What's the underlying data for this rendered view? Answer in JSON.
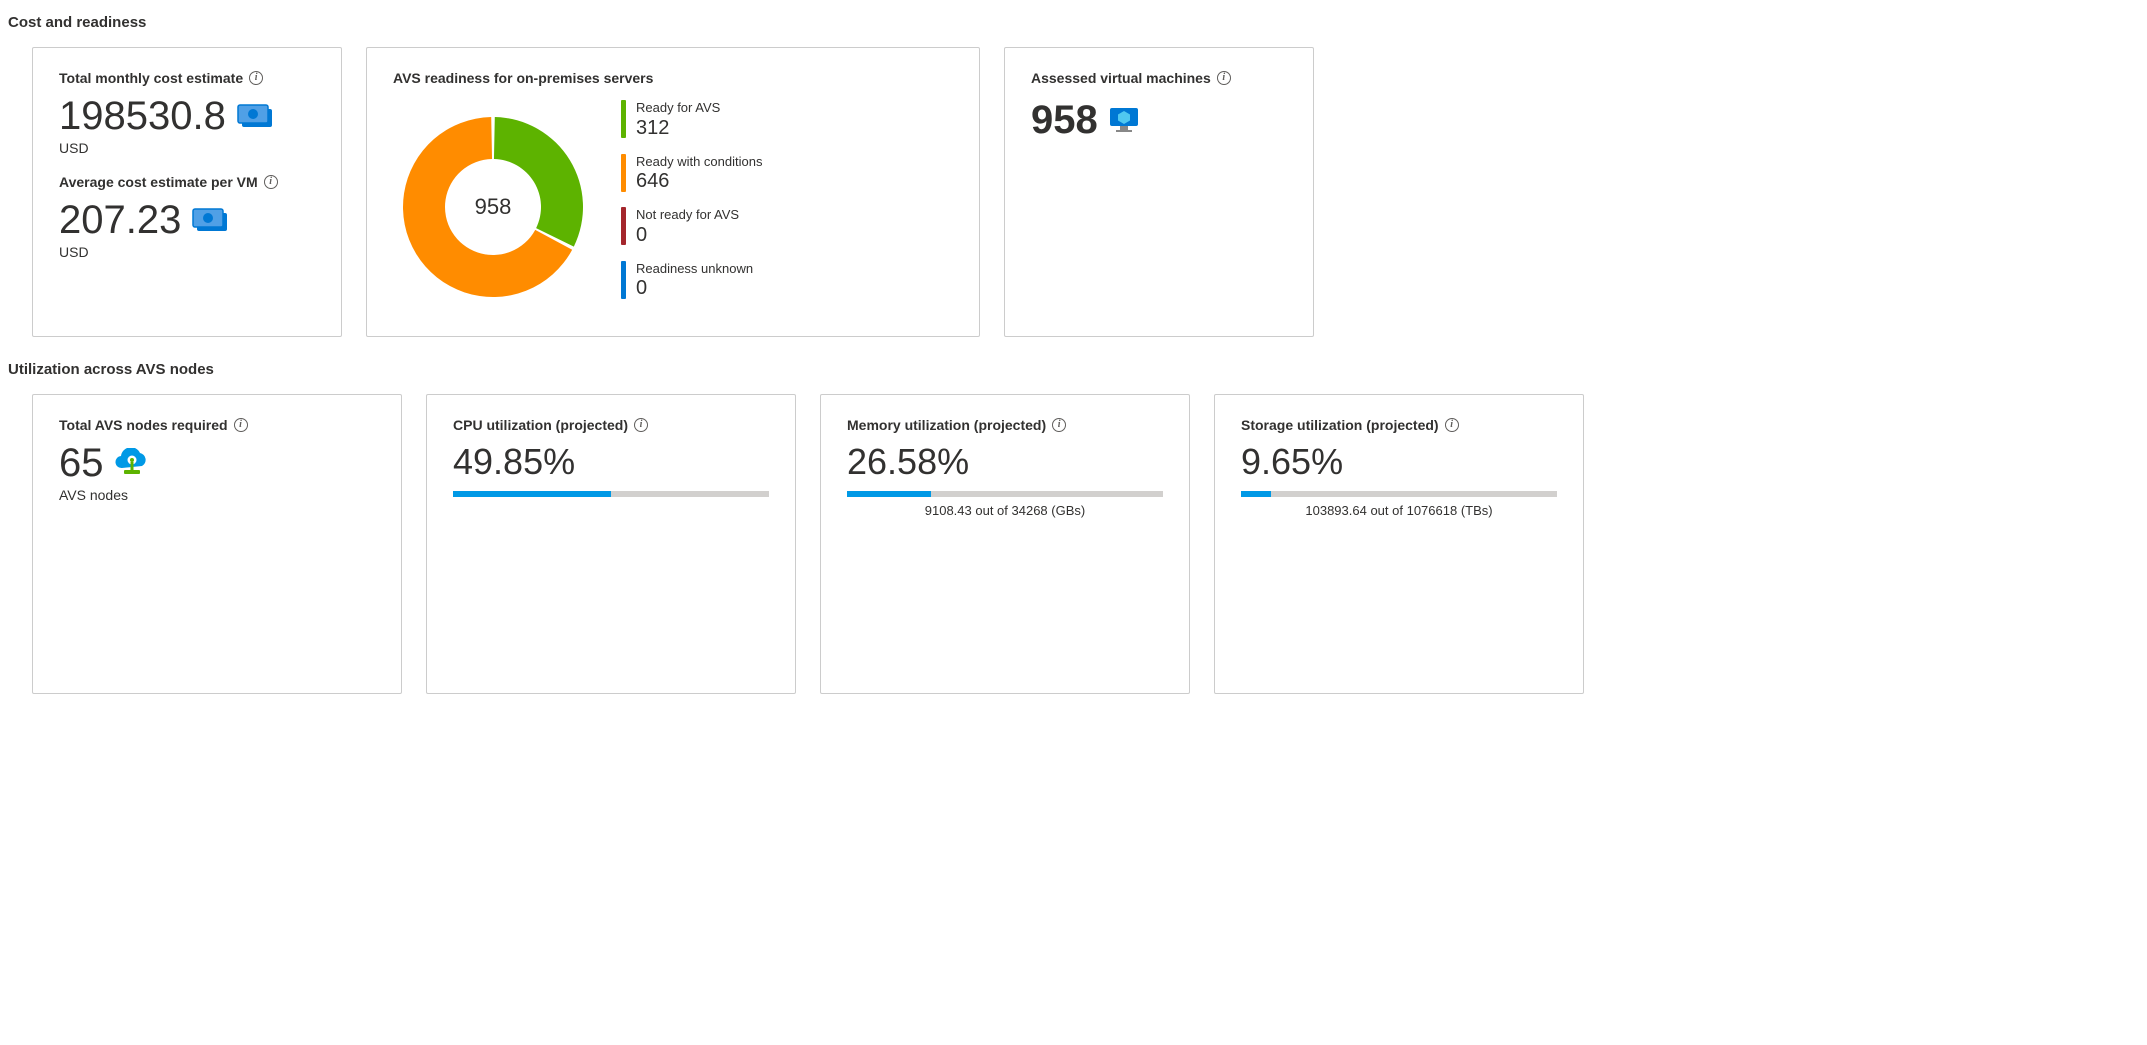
{
  "section1_title": "Cost and readiness",
  "section2_title": "Utilization across AVS nodes",
  "cost": {
    "total_label": "Total monthly cost estimate",
    "total_value": "198530.8",
    "total_unit": "USD",
    "avg_label": "Average cost estimate per VM",
    "avg_value": "207.23",
    "avg_unit": "USD"
  },
  "readiness": {
    "title": "AVS readiness for on-premises servers",
    "total": "958",
    "items": [
      {
        "label": "Ready for AVS",
        "value": "312",
        "color": "#5db300"
      },
      {
        "label": "Ready with conditions",
        "value": "646",
        "color": "#ff8c00"
      },
      {
        "label": "Not ready for AVS",
        "value": "0",
        "color": "#a4262c"
      },
      {
        "label": "Readiness unknown",
        "value": "0",
        "color": "#0078d4"
      }
    ]
  },
  "assessed": {
    "label": "Assessed virtual machines",
    "value": "958"
  },
  "nodes": {
    "label": "Total AVS nodes required",
    "value": "65",
    "unit": "AVS nodes"
  },
  "cpu": {
    "label": "CPU utilization (projected)",
    "pct": "49.85%",
    "fill": 49.85
  },
  "mem": {
    "label": "Memory utilization (projected)",
    "pct": "26.58%",
    "fill": 26.58,
    "sub": "9108.43 out of 34268 (GBs)"
  },
  "storage": {
    "label": "Storage utilization (projected)",
    "pct": "9.65%",
    "fill": 9.65,
    "sub": "103893.64 out of 1076618 (TBs)"
  },
  "chart_data": {
    "type": "pie",
    "title": "AVS readiness for on-premises servers",
    "total": 958,
    "series": [
      {
        "name": "Ready for AVS",
        "value": 312,
        "color": "#5db300"
      },
      {
        "name": "Ready with conditions",
        "value": 646,
        "color": "#ff8c00"
      },
      {
        "name": "Not ready for AVS",
        "value": 0,
        "color": "#a4262c"
      },
      {
        "name": "Readiness unknown",
        "value": 0,
        "color": "#0078d4"
      }
    ]
  }
}
